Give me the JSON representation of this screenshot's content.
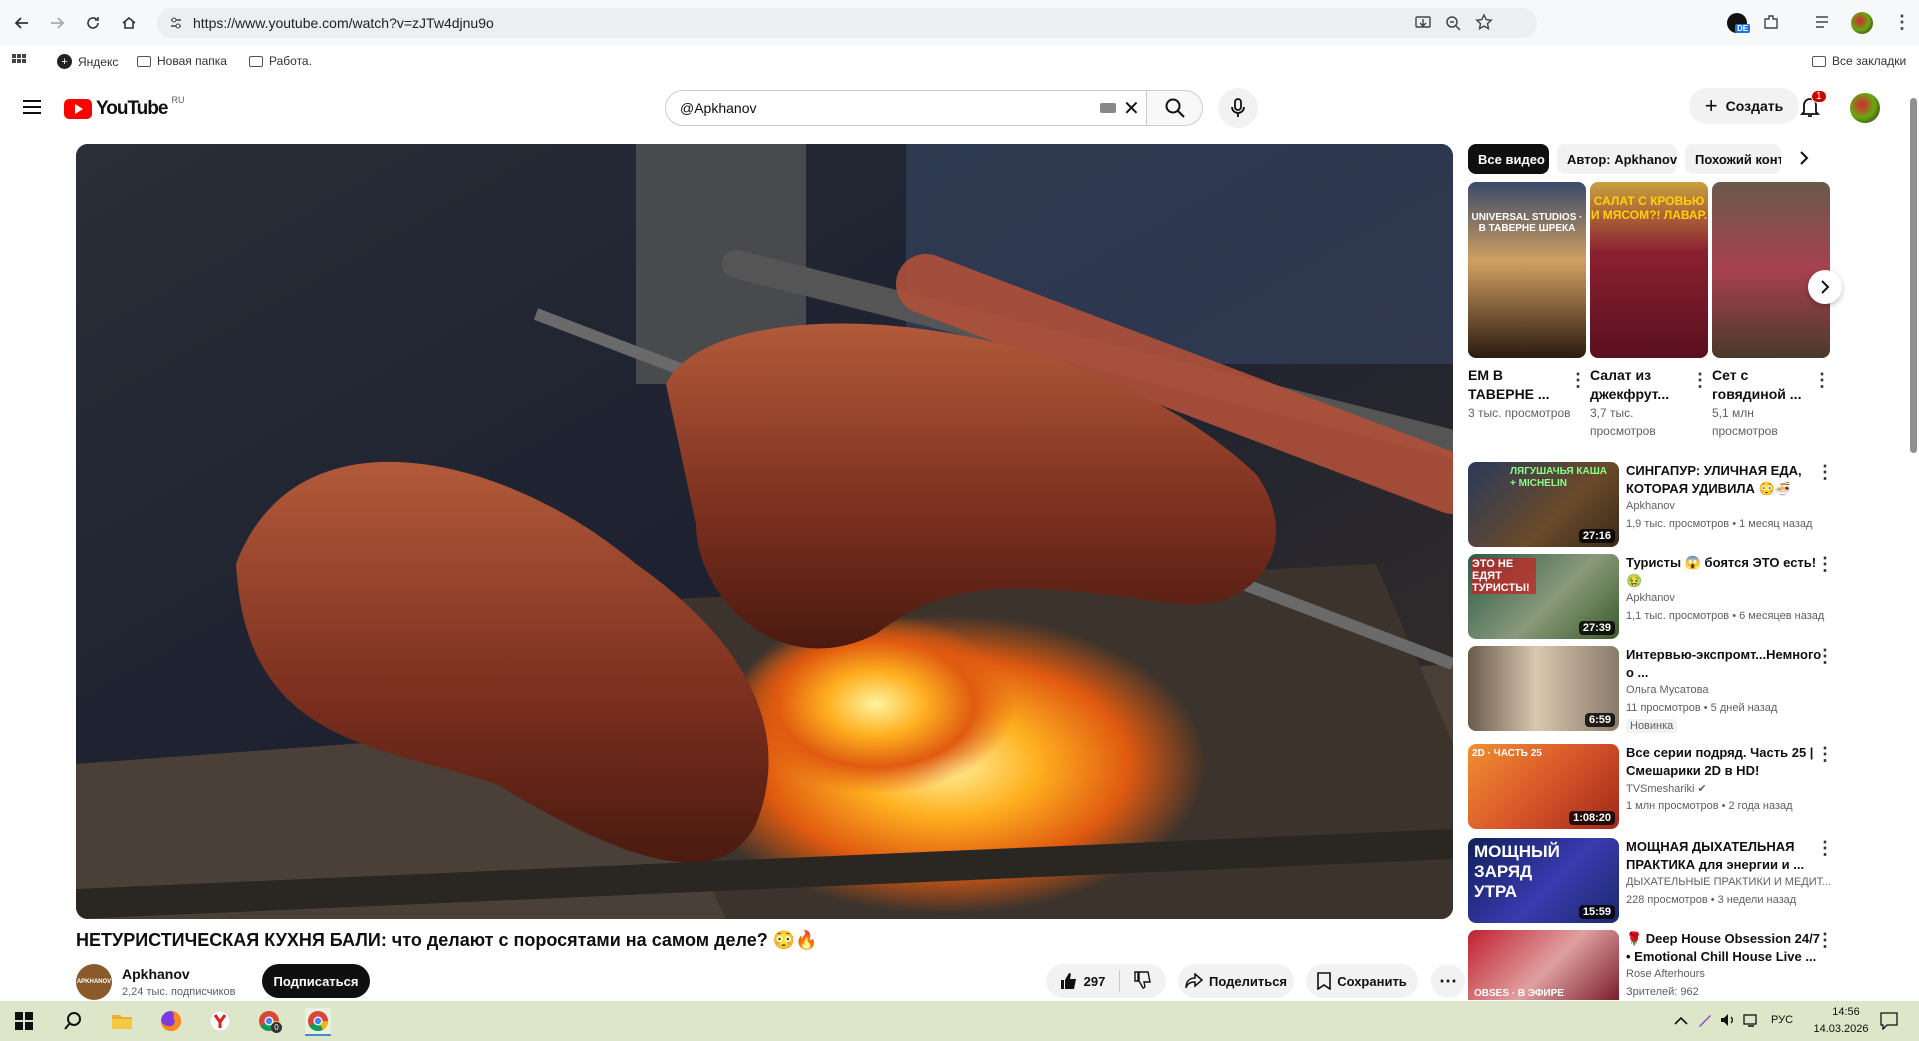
{
  "browser": {
    "url": "https://www.youtube.com/watch?v=zJTw4djnu9o",
    "translate_badge": "DE",
    "bookmarks": [
      "Яндекс",
      "Новая папка",
      "Работа."
    ],
    "all_bookmarks": "Все закладки"
  },
  "header": {
    "logo_text": "YouTube",
    "region": "RU",
    "search_value": "@Apkhanov",
    "create_label": "Создать",
    "notifications_count": "1"
  },
  "video": {
    "title": "НЕТУРИСТИЧЕСКАЯ КУХНЯ БАЛИ: что делают с поросятами на самом деле? 😳🔥",
    "channel": "Apkhanov",
    "subscribers": "2,24 тыс. подписчиков",
    "avatar_text": "APKHANOV",
    "subscribe_label": "Подписаться",
    "likes": "297",
    "share_label": "Поделиться",
    "save_label": "Сохранить"
  },
  "sidebar": {
    "chips": [
      "Все видео",
      "Автор: Apkhanov",
      "Похожий конте"
    ],
    "shorts": [
      {
        "title": "ЕМ В ТАВЕРНЕ ...",
        "views": "3 тыс. просмотров",
        "overlay": "UNIVERSAL STUDIOS · В ТАВЕРНЕ ШРЕКА",
        "bg": "#3a4a6a"
      },
      {
        "title": "Салат из джекфрут...",
        "views": "3,7 тыс. просмотров",
        "overlay": "САЛАТ С КРОВЬЮ И МЯСОМ?! ЛАВАР.",
        "bg": "#7a1e2a"
      },
      {
        "title": "Сет с говядиной ...",
        "views": "5,1 млн просмотров",
        "overlay": "",
        "bg": "#7a5a4a"
      }
    ],
    "recs": [
      {
        "title": "СИНГАПУР: УЛИЧНАЯ ЕДА, КОТОРАЯ УДИВИЛА 😳🍜",
        "channel": "Apkhanov",
        "meta": "1,9 тыс. просмотров • 1 месяц назад",
        "duration": "27:16",
        "overlay": "ЛЯГУШАЧЬЯ КАША + MICHELIN",
        "bg": "#5a3a2a",
        "badge": ""
      },
      {
        "title": "Туристы 😱 боятся ЭТО есть! 🤢",
        "channel": "Apkhanov",
        "meta": "1,1 тыс. просмотров • 6 месяцев назад",
        "duration": "27:39",
        "overlay": "ЭТО НЕ ЕДЯТ ТУРИСТЫ!",
        "bg": "#3a6a5a",
        "badge": ""
      },
      {
        "title": "Интервью-экспромт...Немного о ...",
        "channel": "Ольга Мусатова",
        "meta": "11 просмотров • 5 дней назад",
        "duration": "6:59",
        "overlay": "",
        "bg": "#8a7a6a",
        "badge": "Новинка"
      },
      {
        "title": "Все серии подряд. Часть 25 | Смешарики 2D в HD!",
        "channel": "TVSmeshariki ✔",
        "meta": "1 млн просмотров • 2 года назад",
        "duration": "1:08:20",
        "overlay": "2D · ЧАСТЬ 25",
        "bg": "#d9562a",
        "badge": ""
      },
      {
        "title": "МОЩНАЯ ДЫХАТЕЛЬНАЯ ПРАКТИКА для энергии и ...",
        "channel": "ДЫХАТЕЛЬНЫЕ ПРАКТИКИ И МЕДИТ...",
        "meta": "228 просмотров • 3 недели назад",
        "duration": "15:59",
        "overlay": "МОЩНЫЙ ЗАРЯД УТРА",
        "bg": "#1a2a6a",
        "badge": ""
      },
      {
        "title": "🌹 Deep House Obsession 24/7 • Emotional Chill House Live ...",
        "channel": "Rose Afterhours",
        "meta": "Зрителей: 962",
        "duration": "",
        "overlay": "OBSES · В ЭФИРЕ",
        "bg": "#8a1a2a",
        "badge": ""
      }
    ]
  },
  "taskbar": {
    "language": "РУС",
    "time": "14:56",
    "date": "14.03.2026",
    "chrome_badge": "0"
  }
}
